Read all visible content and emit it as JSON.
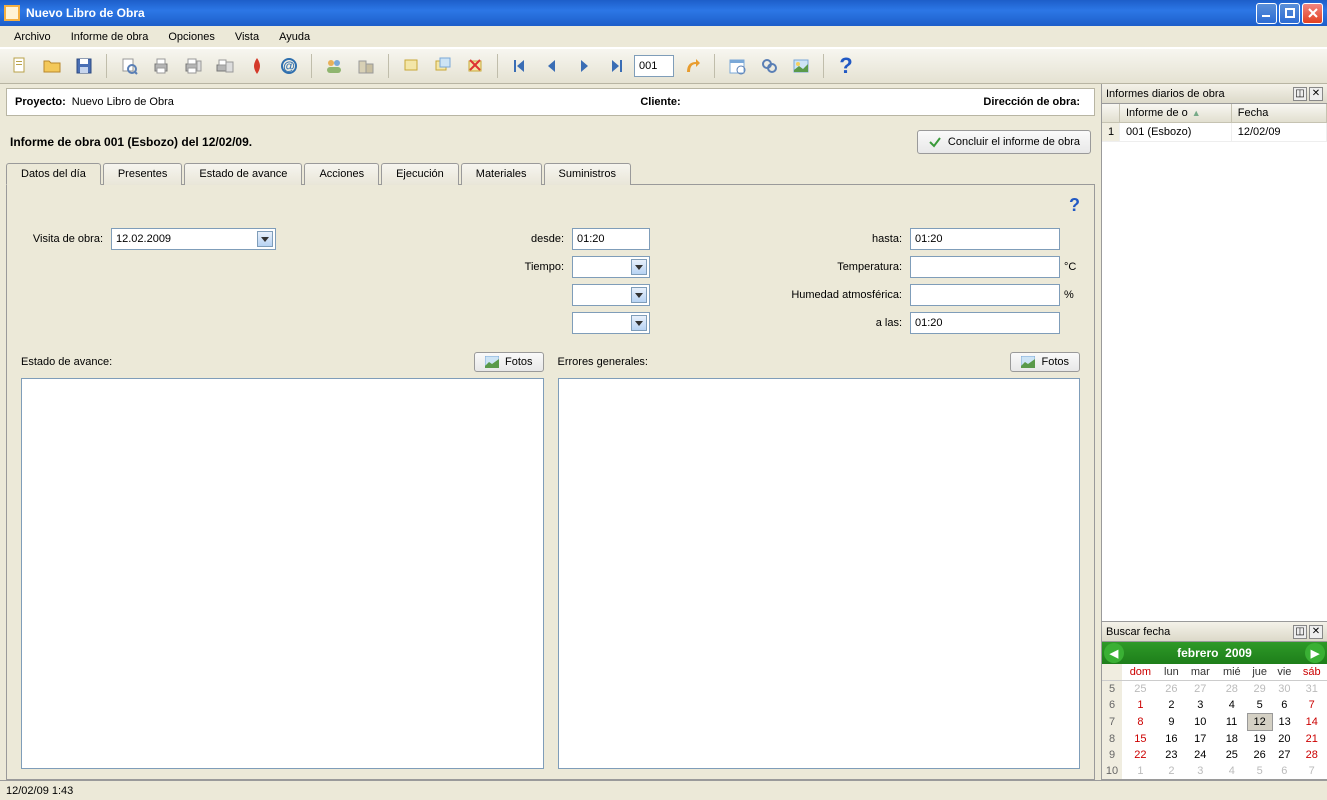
{
  "window": {
    "title": "Nuevo Libro de Obra"
  },
  "menu": {
    "archivo": "Archivo",
    "informe": "Informe de obra",
    "opciones": "Opciones",
    "vista": "Vista",
    "ayuda": "Ayuda"
  },
  "toolbar": {
    "page": "001"
  },
  "info": {
    "proyecto_label": "Proyecto:",
    "proyecto_value": "Nuevo Libro de Obra",
    "cliente_label": "Cliente:",
    "direccion_label": "Dirección de obra:"
  },
  "report": {
    "heading": "Informe de obra 001 (Esbozo) del 12/02/09.",
    "conclude": "Concluir el informe de obra"
  },
  "tabs": {
    "datos": "Datos del día",
    "presentes": "Presentes",
    "estado": "Estado de avance",
    "acciones": "Acciones",
    "ejecucion": "Ejecución",
    "materiales": "Materiales",
    "suministros": "Suministros"
  },
  "form": {
    "visita_label": "Visita de obra:",
    "visita_value": "12.02.2009",
    "desde_label": "desde:",
    "desde_value": "01:20",
    "hasta_label": "hasta:",
    "hasta_value": "01:20",
    "tiempo_label": "Tiempo:",
    "temp_label": "Temperatura:",
    "temp_unit": "°C",
    "humedad_label": "Humedad atmosférica:",
    "humedad_unit": "%",
    "alas_label": "a las:",
    "alas_value": "01:20",
    "estado_label": "Estado de avance:",
    "errores_label": "Errores generales:",
    "fotos": "Fotos"
  },
  "rightdock": {
    "reports_title": "Informes diarios de obra",
    "col_informe": "Informe de o",
    "col_fecha": "Fecha",
    "row_num": "1",
    "row_name": "001 (Esbozo)",
    "row_date": "12/02/09",
    "search_title": "Buscar fecha"
  },
  "calendar": {
    "month": "febrero",
    "year": "2009",
    "dow": [
      "dom",
      "lun",
      "mar",
      "mié",
      "jue",
      "vie",
      "sáb"
    ],
    "weeks": [
      {
        "wk": "5",
        "days": [
          {
            "d": "25",
            "o": true
          },
          {
            "d": "26",
            "o": true
          },
          {
            "d": "27",
            "o": true
          },
          {
            "d": "28",
            "o": true
          },
          {
            "d": "29",
            "o": true
          },
          {
            "d": "30",
            "o": true
          },
          {
            "d": "31",
            "o": true
          }
        ]
      },
      {
        "wk": "6",
        "days": [
          {
            "d": "1",
            "sun": true
          },
          {
            "d": "2"
          },
          {
            "d": "3"
          },
          {
            "d": "4"
          },
          {
            "d": "5"
          },
          {
            "d": "6"
          },
          {
            "d": "7",
            "sat": true
          }
        ]
      },
      {
        "wk": "7",
        "days": [
          {
            "d": "8",
            "sun": true
          },
          {
            "d": "9"
          },
          {
            "d": "10"
          },
          {
            "d": "11"
          },
          {
            "d": "12",
            "sel": true
          },
          {
            "d": "13"
          },
          {
            "d": "14",
            "sat": true
          }
        ]
      },
      {
        "wk": "8",
        "days": [
          {
            "d": "15",
            "sun": true
          },
          {
            "d": "16"
          },
          {
            "d": "17"
          },
          {
            "d": "18"
          },
          {
            "d": "19"
          },
          {
            "d": "20"
          },
          {
            "d": "21",
            "sat": true
          }
        ]
      },
      {
        "wk": "9",
        "days": [
          {
            "d": "22",
            "sun": true
          },
          {
            "d": "23"
          },
          {
            "d": "24"
          },
          {
            "d": "25"
          },
          {
            "d": "26"
          },
          {
            "d": "27"
          },
          {
            "d": "28",
            "sat": true
          }
        ]
      },
      {
        "wk": "10",
        "days": [
          {
            "d": "1",
            "o": true
          },
          {
            "d": "2",
            "o": true
          },
          {
            "d": "3",
            "o": true
          },
          {
            "d": "4",
            "o": true
          },
          {
            "d": "5",
            "o": true
          },
          {
            "d": "6",
            "o": true
          },
          {
            "d": "7",
            "o": true
          }
        ]
      }
    ]
  },
  "status": {
    "datetime": "12/02/09 1:43"
  }
}
